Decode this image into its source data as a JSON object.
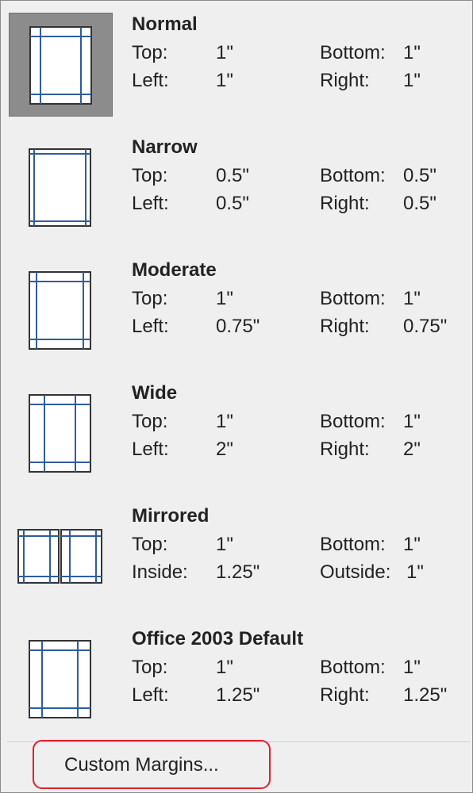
{
  "items": [
    {
      "name": "Normal",
      "top_label": "Top:",
      "top": "1\"",
      "bottom_label": "Bottom:",
      "bottom": "1\"",
      "left_label": "Left:",
      "left": "1\"",
      "right_label": "Right:",
      "right": "1\""
    },
    {
      "name": "Narrow",
      "top_label": "Top:",
      "top": "0.5\"",
      "bottom_label": "Bottom:",
      "bottom": "0.5\"",
      "left_label": "Left:",
      "left": "0.5\"",
      "right_label": "Right:",
      "right": "0.5\""
    },
    {
      "name": "Moderate",
      "top_label": "Top:",
      "top": "1\"",
      "bottom_label": "Bottom:",
      "bottom": "1\"",
      "left_label": "Left:",
      "left": "0.75\"",
      "right_label": "Right:",
      "right": "0.75\""
    },
    {
      "name": "Wide",
      "top_label": "Top:",
      "top": "1\"",
      "bottom_label": "Bottom:",
      "bottom": "1\"",
      "left_label": "Left:",
      "left": "2\"",
      "right_label": "Right:",
      "right": "2\""
    },
    {
      "name": "Mirrored",
      "top_label": "Top:",
      "top": "1\"",
      "bottom_label": "Bottom:",
      "bottom": "1\"",
      "left_label": "Inside:",
      "left": "1.25\"",
      "right_label": "Outside:",
      "right": "1\""
    },
    {
      "name": "Office 2003 Default",
      "top_label": "Top:",
      "top": "1\"",
      "bottom_label": "Bottom:",
      "bottom": "1\"",
      "left_label": "Left:",
      "left": "1.25\"",
      "right_label": "Right:",
      "right": "1.25\""
    }
  ],
  "custom_margins": {
    "label": "Custom Margins..."
  },
  "colors": {
    "margin_line": "#2e5d9c",
    "page_border": "#333333",
    "selected_bg": "#8c8c8c",
    "highlight_outline": "#e0202e"
  },
  "icons": [
    "page-normal-icon",
    "page-narrow-icon",
    "page-moderate-icon",
    "page-wide-icon",
    "page-mirrored-icon",
    "page-office2003-icon"
  ],
  "selected_item": "Normal"
}
